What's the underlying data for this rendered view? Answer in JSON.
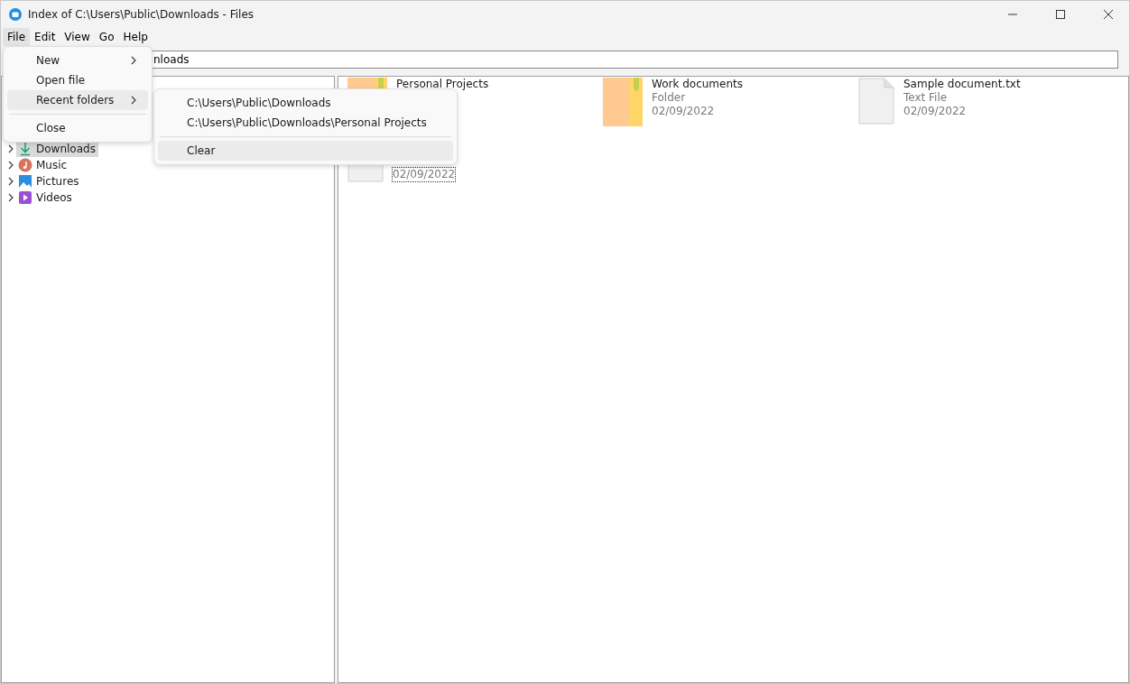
{
  "window": {
    "title": "Index of C:\\Users\\Public\\Downloads - Files"
  },
  "menu_bar": [
    {
      "label": "File",
      "selected": true
    },
    {
      "label": "Edit",
      "selected": false
    },
    {
      "label": "View",
      "selected": false
    },
    {
      "label": "Go",
      "selected": false
    },
    {
      "label": "Help",
      "selected": false
    }
  ],
  "address": {
    "value": "nloads"
  },
  "tree": [
    {
      "label": "Downloads",
      "kind": "downloads",
      "selected": true
    },
    {
      "label": "Music",
      "kind": "music",
      "selected": false
    },
    {
      "label": "Pictures",
      "kind": "pictures",
      "selected": false
    },
    {
      "label": "Videos",
      "kind": "videos",
      "selected": false
    }
  ],
  "files": [
    {
      "kind": "folder",
      "name": "Personal Projects"
    },
    {
      "kind": "folder",
      "name": "Work documents",
      "type": "Folder",
      "date": "02/09/2022"
    },
    {
      "kind": "file",
      "name": "Sample document.txt",
      "type": "Text File",
      "date": "02/09/2022"
    },
    {
      "kind": "file",
      "date": "02/09/2022",
      "focused": true
    }
  ],
  "file_menu": [
    {
      "label": "New",
      "submenu": true,
      "selected": false
    },
    {
      "label": "Open file",
      "submenu": false,
      "selected": false
    },
    {
      "label": "Recent folders",
      "submenu": true,
      "selected": true
    },
    {
      "kind": "separator"
    },
    {
      "label": "Close",
      "submenu": false,
      "selected": false
    }
  ],
  "recent_menu": [
    {
      "label": "C:\\Users\\Public\\Downloads",
      "selected": false
    },
    {
      "label": "C:\\Users\\Public\\Downloads\\Personal Projects",
      "selected": false
    },
    {
      "kind": "separator"
    },
    {
      "label": "Clear",
      "selected": true
    }
  ]
}
